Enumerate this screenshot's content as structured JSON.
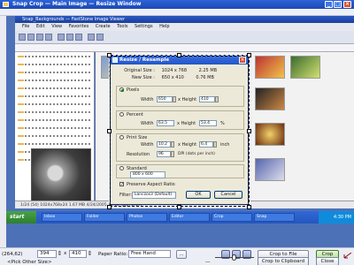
{
  "window": {
    "title": "Snap Crop — Main Image — Resize Window"
  },
  "inner_app": {
    "title": "Snap_Backgrounds — FastStone Image Viewer",
    "menu": [
      "File",
      "Edit",
      "View",
      "Favorites",
      "Create",
      "Tools",
      "Settings",
      "Help"
    ],
    "status": "1/24 (54) 1024x768x24 1.67 MB 4/24/2005 14:12 .jpg [1/54]"
  },
  "taskbar": {
    "start_label": "start",
    "tasks": [
      "Inbox",
      "Folder",
      "Photos",
      "Editor",
      "Crop",
      "Snap"
    ],
    "clock": "4:30 PM"
  },
  "resize_dialog": {
    "title": "Resize / Resample",
    "original_size_label": "Original Size :",
    "original_size_value": "1024 x 768",
    "original_size_mb": "2.25 MB",
    "new_size_label": "New Size :",
    "new_size_value": "650 x 410",
    "new_size_mb": "0.76 MB",
    "pixel_label": "Pixels",
    "width_label": "Width",
    "width_value": "650",
    "height_label": "x Height",
    "height_value": "410",
    "percent_label": "Percent",
    "percent_width": "63.5",
    "percent_height": "53.4",
    "percent_unit": "%",
    "print_label": "Print Size",
    "print_width": "10.2",
    "print_height": "6.4",
    "print_unit": "inch",
    "resolution_label": "Resolution",
    "resolution_value": "96",
    "resolution_unit": "DPI (dots per inch)",
    "standard_label": "Standard",
    "standard_value": "800 x 600",
    "preserve_label": "Preserve Aspect Ratio",
    "filter_label": "Filter:",
    "filter_value": "Lanczos3 (Default)",
    "ok_label": "OK",
    "cancel_label": "Cancel"
  },
  "crop_toolbar": {
    "coords": "(264,62)",
    "width_value": "394",
    "height_value": "410",
    "paper_ratio_label": "Paper Ratio:",
    "paper_ratio_value": "Free Hand",
    "more_label": "...",
    "crop_to_file_label": "Crop to File",
    "crop_label": "Crop",
    "crop_to_clipboard_label": "Crop to Clipboard",
    "close_label": "Close",
    "pick_other_size_label": "<Pick Other Size>",
    "zoom_minus": "—",
    "zoom_plus": "—"
  },
  "colors": {
    "titlebar": "#2c63d8",
    "desktop_blue": "#4d71b7",
    "dialog_face": "#ece9d8",
    "toolbar_face": "#eceef5"
  }
}
